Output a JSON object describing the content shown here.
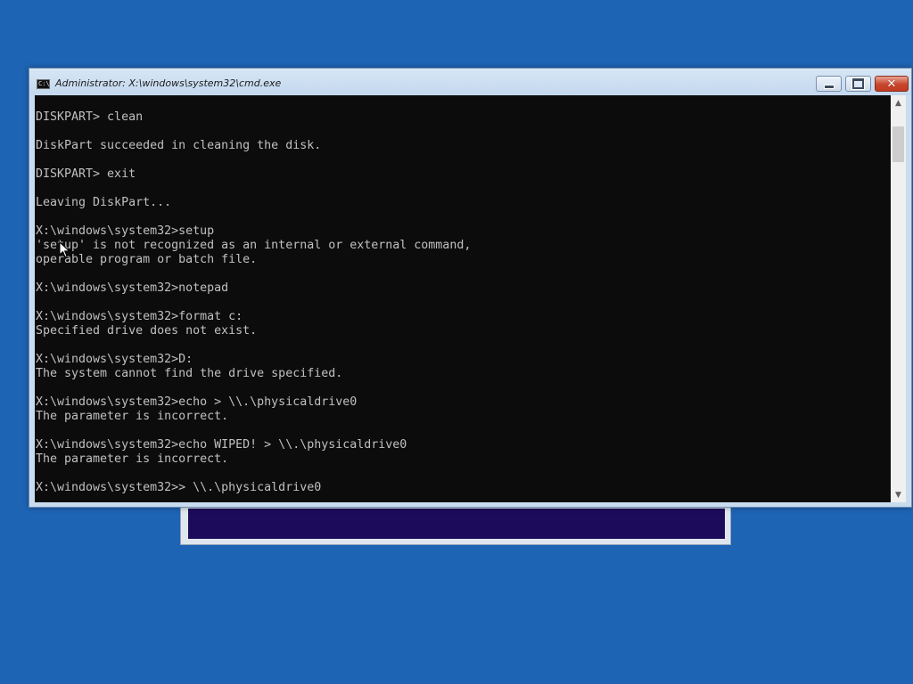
{
  "window": {
    "title": "Administrator: X:\\windows\\system32\\cmd.exe",
    "icon_text": "C:\\",
    "icon": "console-app-icon"
  },
  "controls": {
    "minimize": "minimize-icon",
    "maximize": "maximize-icon",
    "close": "close-icon",
    "close_glyph": "✕"
  },
  "scrollbar": {
    "up_arrow": "▲",
    "down_arrow": "▼"
  },
  "console": {
    "lines": [
      "DISKPART> clean",
      "",
      "DiskPart succeeded in cleaning the disk.",
      "",
      "DISKPART> exit",
      "",
      "Leaving DiskPart...",
      "",
      "X:\\windows\\system32>setup",
      "'setup' is not recognized as an internal or external command,",
      "operable program or batch file.",
      "",
      "X:\\windows\\system32>notepad",
      "",
      "X:\\windows\\system32>format c:",
      "Specified drive does not exist.",
      "",
      "X:\\windows\\system32>D:",
      "The system cannot find the drive specified.",
      "",
      "X:\\windows\\system32>echo > \\\\.\\physicaldrive0",
      "The parameter is incorrect.",
      "",
      "X:\\windows\\system32>echo WIPED! > \\\\.\\physicaldrive0",
      "The parameter is incorrect.",
      "",
      "X:\\windows\\system32>> \\\\.\\physicaldrive0"
    ],
    "text_color": "#c0c0c0",
    "background_color": "#0c0c0c"
  },
  "desktop": {
    "background_color": "#1e64b4"
  }
}
